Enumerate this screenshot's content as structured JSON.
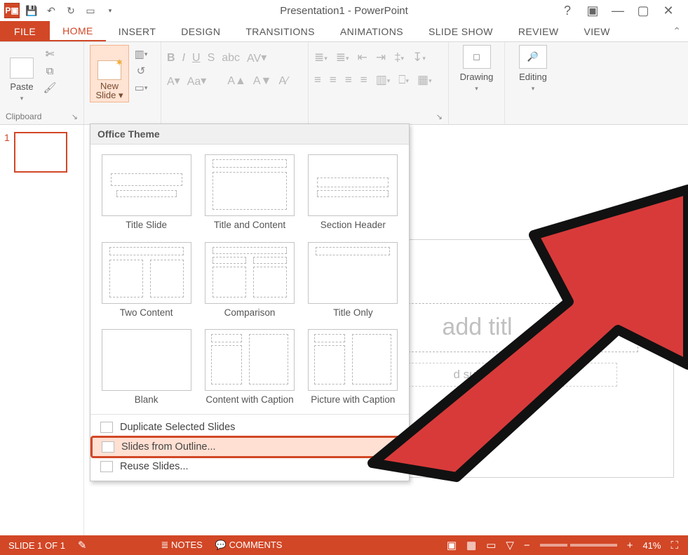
{
  "app": {
    "title": "Presentation1 - PowerPoint"
  },
  "tabs": {
    "file": "FILE",
    "home": "HOME",
    "insert": "INSERT",
    "design": "DESIGN",
    "trans": "TRANSITIONS",
    "anim": "ANIMATIONS",
    "show": "SLIDE SHOW",
    "review": "REVIEW",
    "view": "VIEW"
  },
  "ribbon": {
    "clipboard": {
      "label": "Clipboard",
      "paste": "Paste"
    },
    "slides": {
      "newslide": "New\nSlide ▾"
    },
    "drawing": {
      "label": "Drawing"
    },
    "editing": {
      "label": "Editing"
    }
  },
  "slide": {
    "title_placeholder": "add titl",
    "subtitle_placeholder": "d subtitle"
  },
  "dropdown": {
    "header": "Office Theme",
    "layouts": [
      "Title Slide",
      "Title and Content",
      "Section Header",
      "Two Content",
      "Comparison",
      "Title Only",
      "Blank",
      "Content with Caption",
      "Picture with Caption"
    ],
    "dup": "Duplicate Selected Slides",
    "outline": "Slides from Outline...",
    "reuse": "Reuse Slides..."
  },
  "statusbar": {
    "slide": "SLIDE 1 OF 1",
    "notes": "NOTES",
    "comments": "COMMENTS",
    "zoom": "41%"
  },
  "thumbpane": {
    "num": "1"
  }
}
